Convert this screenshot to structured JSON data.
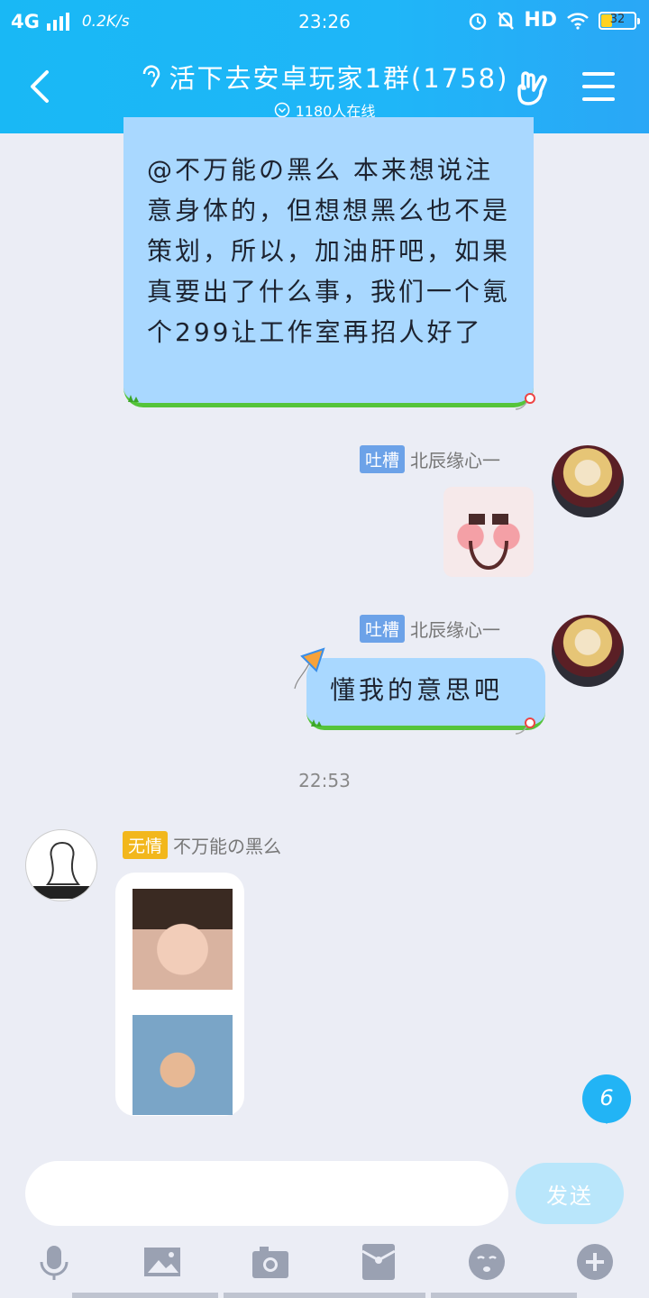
{
  "status_bar": {
    "network": "4G",
    "speed": "0.2K/s",
    "time": "23:26",
    "hd": "HD",
    "battery": "32"
  },
  "header": {
    "title": "活下去安卓玩家1群(1758)",
    "online": "1180人在线"
  },
  "messages": {
    "long_text": "@不万能の黑么 本来想说注意身体的，但想想黑么也不是策划，所以，加油肝吧，如果真要出了什么事，我们一个氪个299让工作室再招人好了",
    "sender1_tag": "吐槽",
    "sender1_name": "北辰缘心一",
    "sender2_tag": "吐槽",
    "sender2_name": "北辰缘心一",
    "short_text": "懂我的意思吧",
    "time_separator": "22:53",
    "sender3_tag": "无情",
    "sender3_name": "不万能の黑么",
    "unread_count": "6"
  },
  "input": {
    "placeholder": "",
    "send_label": "发送"
  },
  "colors": {
    "header_bg": "#1fb6f8",
    "bubble_bg": "#a9d8ff",
    "tag_blue": "#6ca2e8",
    "tag_orange": "#f2b71c"
  },
  "icons": [
    "back-icon",
    "ear-icon",
    "clock-icon",
    "rock-hand-icon",
    "menu-icon",
    "microphone-icon",
    "picture-icon",
    "camera-icon",
    "red-packet-icon",
    "emoji-icon",
    "plus-icon"
  ]
}
